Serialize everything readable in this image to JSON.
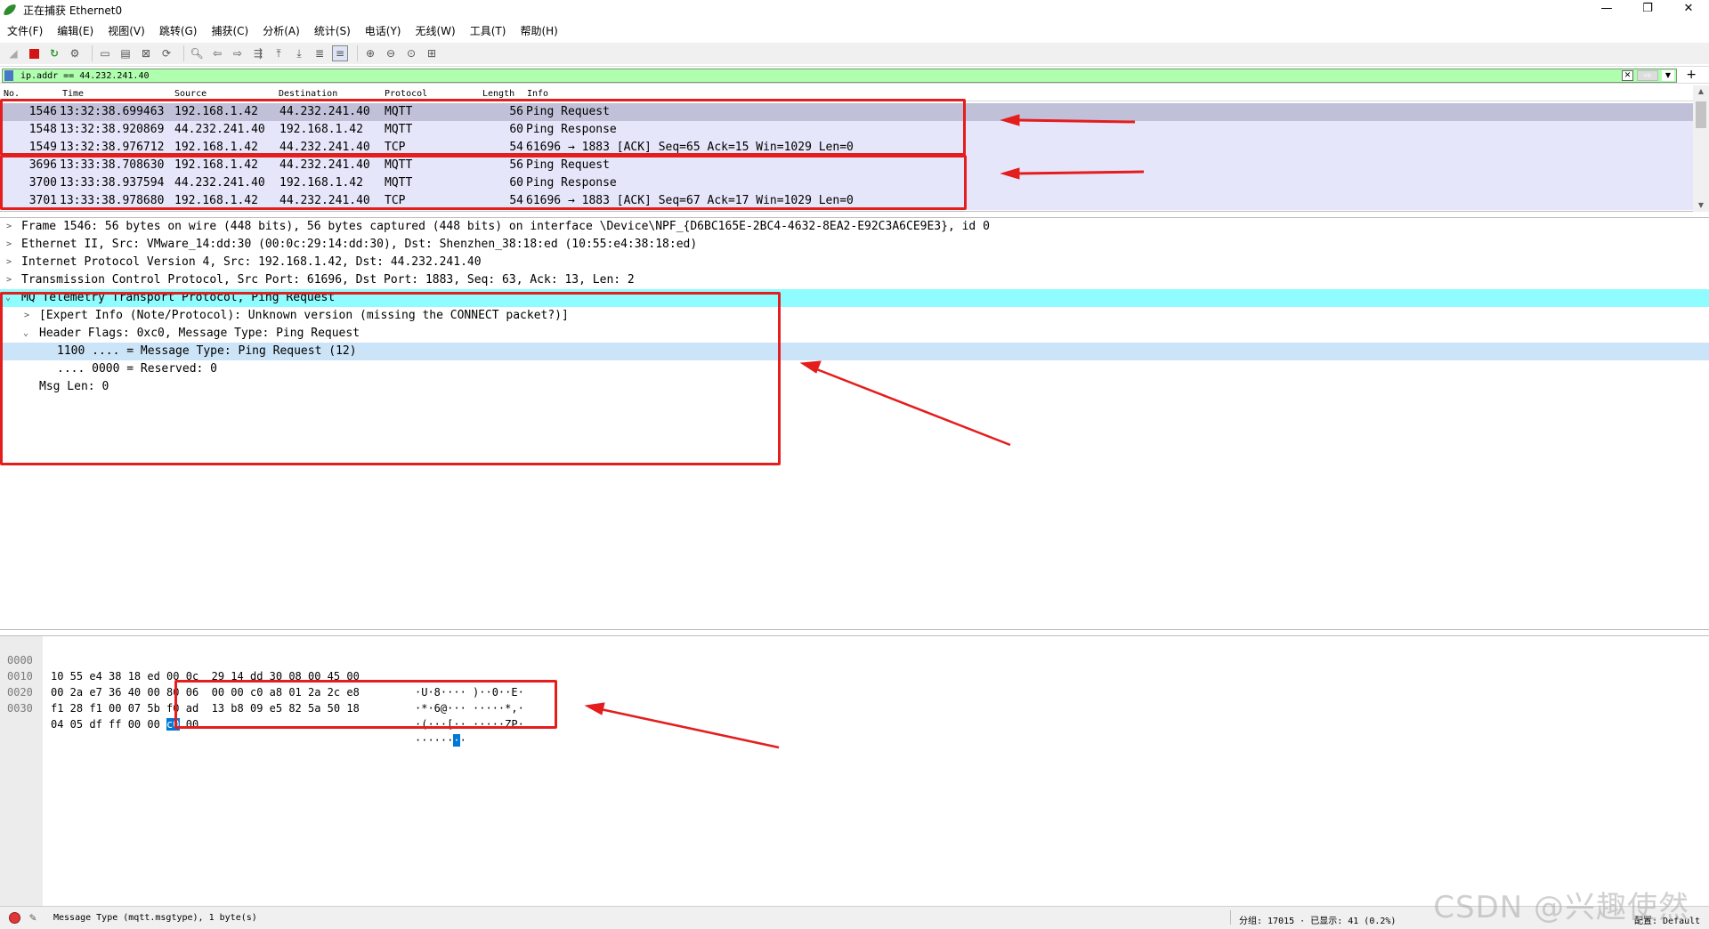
{
  "window": {
    "title": "正在捕获 Ethernet0",
    "minimize": "—",
    "restore": "❐",
    "close": "✕"
  },
  "menu": [
    "文件(F)",
    "编辑(E)",
    "视图(V)",
    "跳转(G)",
    "捕获(C)",
    "分析(A)",
    "统计(S)",
    "电话(Y)",
    "无线(W)",
    "工具(T)",
    "帮助(H)"
  ],
  "filter": {
    "value": "ip.addr == 44.232.241.40",
    "add": "+"
  },
  "packet_list": {
    "columns": [
      "No.",
      "Time",
      "Source",
      "Destination",
      "Protocol",
      "Length",
      "Info"
    ],
    "rows": [
      {
        "no": "1546",
        "time": "13:32:38.699463",
        "src": "192.168.1.42",
        "dst": "44.232.241.40",
        "proto": "MQTT",
        "len": "56",
        "info": "Ping Request"
      },
      {
        "no": "1548",
        "time": "13:32:38.920869",
        "src": "44.232.241.40",
        "dst": "192.168.1.42",
        "proto": "MQTT",
        "len": "60",
        "info": "Ping Response"
      },
      {
        "no": "1549",
        "time": "13:32:38.976712",
        "src": "192.168.1.42",
        "dst": "44.232.241.40",
        "proto": "TCP",
        "len": "54",
        "info": "61696 → 1883 [ACK] Seq=65 Ack=15 Win=1029 Len=0"
      },
      {
        "no": "3696",
        "time": "13:33:38.708630",
        "src": "192.168.1.42",
        "dst": "44.232.241.40",
        "proto": "MQTT",
        "len": "56",
        "info": "Ping Request"
      },
      {
        "no": "3700",
        "time": "13:33:38.937594",
        "src": "44.232.241.40",
        "dst": "192.168.1.42",
        "proto": "MQTT",
        "len": "60",
        "info": "Ping Response"
      },
      {
        "no": "3701",
        "time": "13:33:38.978680",
        "src": "192.168.1.42",
        "dst": "44.232.241.40",
        "proto": "TCP",
        "len": "54",
        "info": "61696 → 1883 [ACK] Seq=67 Ack=17 Win=1029 Len=0"
      }
    ]
  },
  "details": {
    "frame": "Frame 1546: 56 bytes on wire (448 bits), 56 bytes captured (448 bits) on interface \\Device\\NPF_{D6BC165E-2BC4-4632-8EA2-E92C3A6CE9E3}, id 0",
    "ethernet": "Ethernet II, Src: VMware_14:dd:30 (00:0c:29:14:dd:30), Dst: Shenzhen_38:18:ed (10:55:e4:38:18:ed)",
    "ip": "Internet Protocol Version 4, Src: 192.168.1.42, Dst: 44.232.241.40",
    "tcp": "Transmission Control Protocol, Src Port: 61696, Dst Port: 1883, Seq: 63, Ack: 13, Len: 2",
    "mqtt": "MQ Telemetry Transport Protocol, Ping Request",
    "expert": "[Expert Info (Note/Protocol): Unknown version (missing the CONNECT packet?)]",
    "header_flags": "Header Flags: 0xc0, Message Type: Ping Request",
    "msg_type": "1100 .... = Message Type: Ping Request (12)",
    "reserved": ".... 0000 = Reserved: 0",
    "msg_len": "Msg Len: 0"
  },
  "bytes": [
    {
      "offset": "0000",
      "hex_a": "10 55 e4 38 18 ed 00 0c",
      "hex_b": "29 14 dd 30 08 00 45 00",
      "ascii": "·U·8···· )··0··E·"
    },
    {
      "offset": "0010",
      "hex_a": "00 2a e7 36 40 00 80 06",
      "hex_b": "00 00 c0 a8 01 2a 2c e8",
      "ascii": "·*·6@··· ·····*,·"
    },
    {
      "offset": "0020",
      "hex_a": "f1 28 f1 00 07 5b f0 ad",
      "hex_b": "13 b8 09 e5 82 5a 50 18",
      "ascii": "·(···[·· ·····ZP·"
    },
    {
      "offset": "0030",
      "hex_pre": "04 05 df ff 00 00 ",
      "hex_sel": "c0",
      "hex_post": " 00",
      "ascii_pre": "······",
      "ascii_sel": "·",
      "ascii_post": "·"
    }
  ],
  "status": {
    "field_info": "Message Type (mqtt.msgtype), 1 byte(s)",
    "packets": "分组: 17015 · 已显示: 41 (0.2%)",
    "profile": "配置: Default"
  },
  "watermark": "CSDN @兴趣使然",
  "colors": {
    "packet_row": "#e6e6fa",
    "selected_row": "#c0c0d8",
    "filter_valid": "#afffaf",
    "mqtt_highlight": "#8ffcff",
    "field_highlight": "#cce4f7",
    "annotation_red": "#e41d1d"
  }
}
